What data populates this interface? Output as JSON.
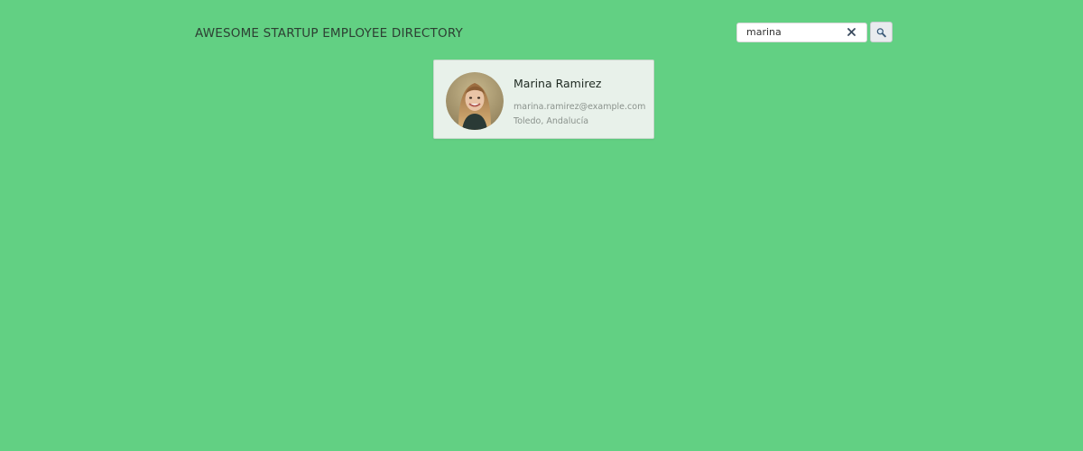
{
  "header": {
    "title": "AWESOME STARTUP EMPLOYEE DIRECTORY"
  },
  "search": {
    "value": "marina",
    "clear_icon": "close-icon",
    "button_icon": "magnifier-icon"
  },
  "results": [
    {
      "name": "Marina Ramirez",
      "email": "marina.ramirez@example.com",
      "location": "Toledo, Andalucía",
      "avatar_icon": "avatar-photo"
    }
  ],
  "colors": {
    "background": "#62d083",
    "card_background": "#e8f1ea",
    "title_text": "#2d3f33",
    "muted_text": "#8a928c"
  }
}
